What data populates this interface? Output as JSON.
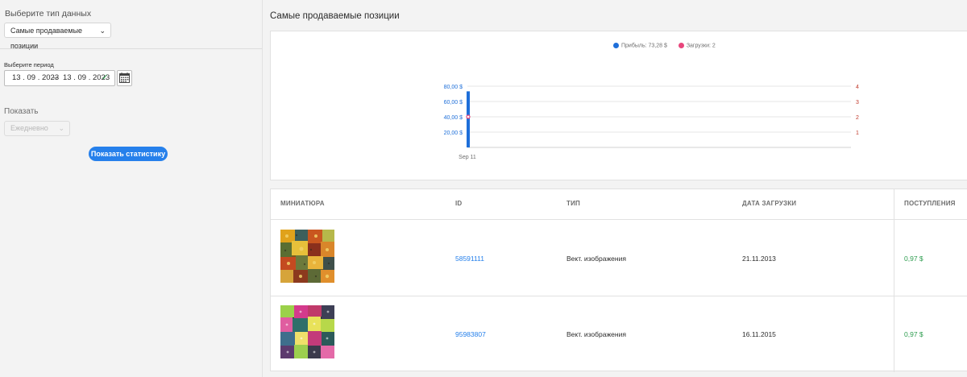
{
  "filters": {
    "data_type_label": "Выберите тип данных",
    "data_type_value": "Самые продаваемые позиции",
    "period_label": "Выберите период",
    "date_from": "13 . 09 . 2023",
    "date_separator": "–",
    "date_to": "13 . 09 . 2023",
    "show_label": "Показать",
    "show_value": "Ежедневно",
    "submit_label": "Показать статистику"
  },
  "main": {
    "title": "Самые продаваемые позиции"
  },
  "legend": {
    "profit": "Прибыль: 73,28 $",
    "downloads": "Загрузки: 2"
  },
  "colors": {
    "accent": "#2680eb",
    "profit": "#1e6fd9",
    "downloads": "#e8467c",
    "money": "#2d9d4f"
  },
  "chart_data": {
    "type": "bar",
    "categories": [
      "Sep 11"
    ],
    "series": [
      {
        "name": "Прибыль: 73,28 $",
        "axis": "left",
        "type": "bar",
        "values": [
          73.28
        ]
      },
      {
        "name": "Загрузки: 2",
        "axis": "right",
        "type": "scatter",
        "values": [
          2
        ]
      }
    ],
    "y_left_ticks": [
      "20,00 $",
      "40,00 $",
      "60,00 $",
      "80,00 $"
    ],
    "y_left_values": [
      20,
      40,
      60,
      80
    ],
    "y_right_ticks": [
      "1",
      "2",
      "3",
      "4"
    ],
    "y_right_values": [
      1,
      2,
      3,
      4
    ],
    "ylim_left": [
      0,
      80
    ],
    "ylim_right": [
      0,
      4
    ],
    "grid": true,
    "legend_position": "top"
  },
  "table": {
    "headers": [
      "МИНИАТЮРА",
      "ID",
      "ТИП",
      "ДАТА ЗАГРУЗКИ",
      "ПОСТУПЛЕНИЯ"
    ],
    "rows": [
      {
        "id": "58591111",
        "type": "Вект. изображения",
        "date": "21.11.2013",
        "revenue": "0,97 $"
      },
      {
        "id": "95983807",
        "type": "Вект. изображения",
        "date": "16.11.2015",
        "revenue": "0,97 $"
      }
    ]
  },
  "icons": {
    "calendar": "calendar-icon",
    "check": "check-icon",
    "chevron": "chevron-down-icon"
  }
}
